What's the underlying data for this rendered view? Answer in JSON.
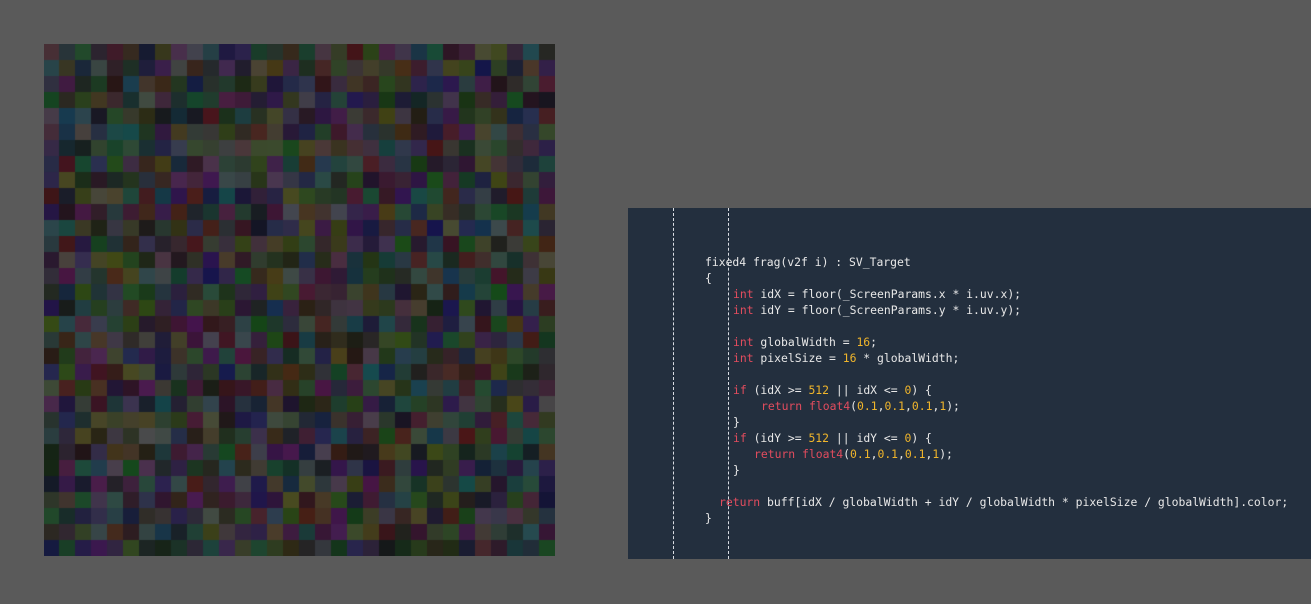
{
  "colors": {
    "background": "#5a5a5a",
    "code_panel": "#232f3e",
    "keyword": "#e24c5e",
    "number": "#f0b52b",
    "text": "#e8e8e8"
  },
  "render_preview": {
    "grid_columns": 32,
    "grid_rows": 32
  },
  "code": {
    "lines": [
      {
        "indent": 77,
        "tokens": [
          {
            "t": "txt",
            "v": "fixed4 frag(v2f i) : SV_Target"
          }
        ]
      },
      {
        "indent": 77,
        "tokens": [
          {
            "t": "txt",
            "v": "{"
          }
        ]
      },
      {
        "indent": 105,
        "tokens": [
          {
            "t": "kw",
            "v": "int"
          },
          {
            "t": "txt",
            "v": " idX = floor(_ScreenParams.x * i.uv.x);"
          }
        ]
      },
      {
        "indent": 105,
        "tokens": [
          {
            "t": "kw",
            "v": "int"
          },
          {
            "t": "txt",
            "v": " idY = floor(_ScreenParams.y * i.uv.y);"
          }
        ]
      },
      {
        "indent": 105,
        "tokens": []
      },
      {
        "indent": 105,
        "tokens": [
          {
            "t": "kw",
            "v": "int"
          },
          {
            "t": "txt",
            "v": " globalWidth = "
          },
          {
            "t": "num",
            "v": "16"
          },
          {
            "t": "txt",
            "v": ";"
          }
        ]
      },
      {
        "indent": 105,
        "tokens": [
          {
            "t": "kw",
            "v": "int"
          },
          {
            "t": "txt",
            "v": " pixelSize = "
          },
          {
            "t": "num",
            "v": "16"
          },
          {
            "t": "txt",
            "v": " * globalWidth;"
          }
        ]
      },
      {
        "indent": 105,
        "tokens": []
      },
      {
        "indent": 105,
        "tokens": [
          {
            "t": "kw",
            "v": "if"
          },
          {
            "t": "txt",
            "v": " (idX >= "
          },
          {
            "t": "num",
            "v": "512"
          },
          {
            "t": "txt",
            "v": " || idX <= "
          },
          {
            "t": "num",
            "v": "0"
          },
          {
            "t": "txt",
            "v": ") {"
          }
        ]
      },
      {
        "indent": 133,
        "tokens": [
          {
            "t": "kw",
            "v": "return"
          },
          {
            "t": "txt",
            "v": " "
          },
          {
            "t": "kw",
            "v": "float4"
          },
          {
            "t": "txt",
            "v": "("
          },
          {
            "t": "num",
            "v": "0.1"
          },
          {
            "t": "txt",
            "v": ","
          },
          {
            "t": "num",
            "v": "0.1"
          },
          {
            "t": "txt",
            "v": ","
          },
          {
            "t": "num",
            "v": "0.1"
          },
          {
            "t": "txt",
            "v": ","
          },
          {
            "t": "num",
            "v": "1"
          },
          {
            "t": "txt",
            "v": ");"
          }
        ]
      },
      {
        "indent": 105,
        "tokens": [
          {
            "t": "txt",
            "v": "}"
          }
        ]
      },
      {
        "indent": 105,
        "tokens": [
          {
            "t": "kw",
            "v": "if"
          },
          {
            "t": "txt",
            "v": " (idY >= "
          },
          {
            "t": "num",
            "v": "512"
          },
          {
            "t": "txt",
            "v": " || idY <= "
          },
          {
            "t": "num",
            "v": "0"
          },
          {
            "t": "txt",
            "v": ") {"
          }
        ]
      },
      {
        "indent": 126,
        "tokens": [
          {
            "t": "kw",
            "v": "return"
          },
          {
            "t": "txt",
            "v": " "
          },
          {
            "t": "kw",
            "v": "float4"
          },
          {
            "t": "txt",
            "v": "("
          },
          {
            "t": "num",
            "v": "0.1"
          },
          {
            "t": "txt",
            "v": ","
          },
          {
            "t": "num",
            "v": "0.1"
          },
          {
            "t": "txt",
            "v": ","
          },
          {
            "t": "num",
            "v": "0.1"
          },
          {
            "t": "txt",
            "v": ","
          },
          {
            "t": "num",
            "v": "1"
          },
          {
            "t": "txt",
            "v": ");"
          }
        ]
      },
      {
        "indent": 105,
        "tokens": [
          {
            "t": "txt",
            "v": "}"
          }
        ]
      },
      {
        "indent": 105,
        "tokens": []
      },
      {
        "indent": 91,
        "tokens": [
          {
            "t": "kw",
            "v": "return"
          },
          {
            "t": "txt",
            "v": " buff[idX / globalWidth + idY / globalWidth * pixelSize / globalWidth].color;"
          }
        ]
      },
      {
        "indent": 77,
        "tokens": [
          {
            "t": "txt",
            "v": "}"
          }
        ]
      }
    ]
  }
}
